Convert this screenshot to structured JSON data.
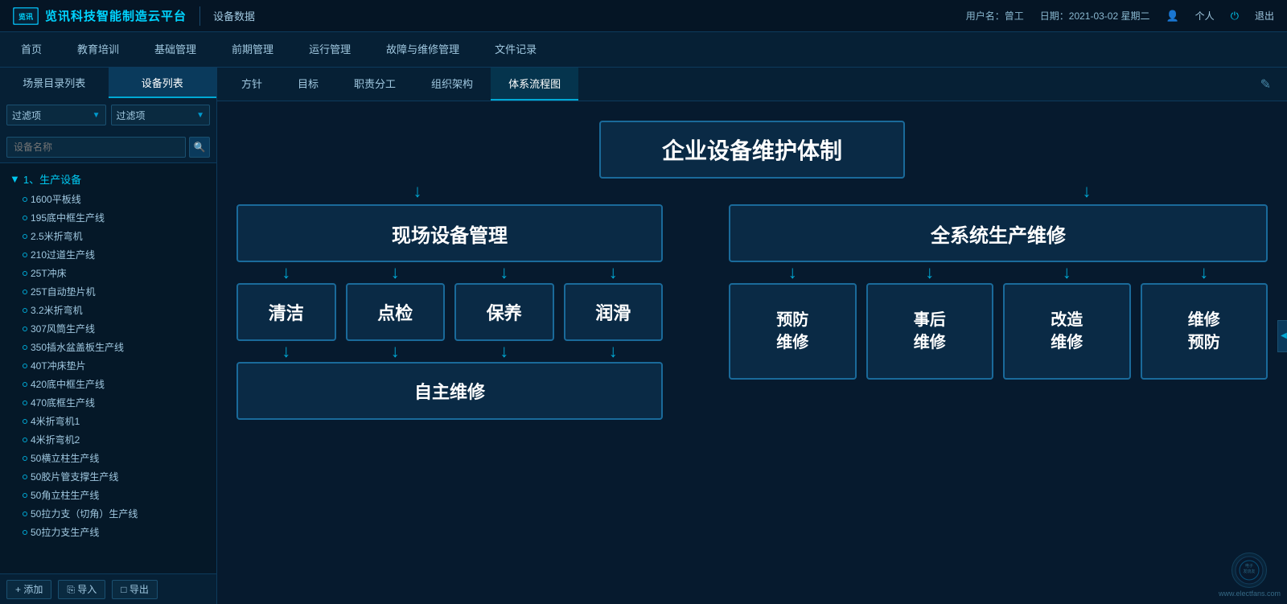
{
  "header": {
    "logo_text": "览讯科技智能制造云平台",
    "logo_icon": "览讯",
    "module_title": "设备数据",
    "user_info": "用户名：曾工",
    "date_info": "日期：2021-03-02 星期二",
    "personal_label": "个人",
    "logout_label": "退出"
  },
  "nav": {
    "items": [
      {
        "label": "首页",
        "active": false
      },
      {
        "label": "教育培训",
        "active": false
      },
      {
        "label": "基础管理",
        "active": false
      },
      {
        "label": "前期管理",
        "active": false
      },
      {
        "label": "运行管理",
        "active": false
      },
      {
        "label": "故障与维修管理",
        "active": false
      },
      {
        "label": "文件记录",
        "active": false
      }
    ]
  },
  "sidebar": {
    "tabs": [
      {
        "label": "场景目录列表",
        "active": false
      },
      {
        "label": "设备列表",
        "active": true
      }
    ],
    "filter1": "过滤项",
    "filter2": "过滤项",
    "search_placeholder": "设备名称",
    "tree_group": "1、生产设备",
    "tree_items": [
      {
        "label": "1600平板线",
        "active": false
      },
      {
        "label": "195底中框生产线",
        "active": false
      },
      {
        "label": "2.5米折弯机",
        "active": false
      },
      {
        "label": "210过道生产线",
        "active": false
      },
      {
        "label": "25T冲床",
        "active": false
      },
      {
        "label": "25T自动垫片机",
        "active": false
      },
      {
        "label": "3.2米折弯机",
        "active": false
      },
      {
        "label": "307风筒生产线",
        "active": false
      },
      {
        "label": "350插水盆盖板生产线",
        "active": false
      },
      {
        "label": "40T冲床垫片",
        "active": false
      },
      {
        "label": "420底中框生产线",
        "active": false
      },
      {
        "label": "470底框生产线",
        "active": false
      },
      {
        "label": "4米折弯机1",
        "active": false
      },
      {
        "label": "4米折弯机2",
        "active": false
      },
      {
        "label": "50横立柱生产线",
        "active": false
      },
      {
        "label": "50胶片管支撑生产线",
        "active": false
      },
      {
        "label": "50角立柱生产线",
        "active": false
      },
      {
        "label": "50拉力支（切角）生产线",
        "active": false
      },
      {
        "label": "50拉力支生产线",
        "active": false
      }
    ],
    "footer_btns": [
      {
        "label": "+ 添加",
        "icon": "+"
      },
      {
        "label": "⎘ 导入",
        "icon": "⎘"
      },
      {
        "label": "□ 导出",
        "icon": "□"
      }
    ]
  },
  "sub_tabs": {
    "items": [
      {
        "label": "方针",
        "active": false
      },
      {
        "label": "目标",
        "active": false
      },
      {
        "label": "职责分工",
        "active": false
      },
      {
        "label": "组织架构",
        "active": false
      },
      {
        "label": "体系流程图",
        "active": true
      }
    ]
  },
  "flowchart": {
    "title": "企业设备维护体制",
    "left_main": "现场设备管理",
    "right_main": "全系统生产维修",
    "left_items": [
      "清洁",
      "点检",
      "保养",
      "润滑"
    ],
    "left_bottom": "自主维修",
    "right_items": [
      "预防\n维修",
      "事后\n维修",
      "改造\n维修",
      "维修\n预防"
    ]
  },
  "watermark": {
    "site": "www.electfans.com",
    "label": "电子发烧友"
  }
}
